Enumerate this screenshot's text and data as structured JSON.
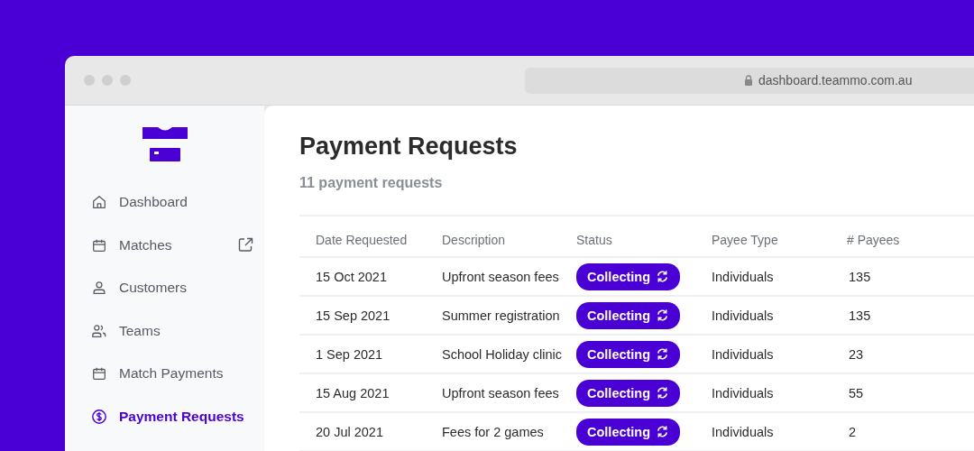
{
  "browser": {
    "url": "dashboard.teammo.com.au"
  },
  "sidebar": {
    "items": [
      {
        "label": "Dashboard",
        "selected": false,
        "external": false
      },
      {
        "label": "Matches",
        "selected": false,
        "external": true
      },
      {
        "label": "Customers",
        "selected": false,
        "external": false
      },
      {
        "label": "Teams",
        "selected": false,
        "external": false
      },
      {
        "label": "Match Payments",
        "selected": false,
        "external": false
      },
      {
        "label": "Payment Requests",
        "selected": true,
        "external": false
      }
    ]
  },
  "page": {
    "title": "Payment Requests",
    "subtitle": "11 payment requests"
  },
  "table": {
    "columns": [
      "Date Requested",
      "Description",
      "Status",
      "Payee Type",
      "# Payees"
    ],
    "rows": [
      {
        "date": "15 Oct 2021",
        "description": "Upfront season fees",
        "status": "Collecting",
        "payee_type": "Individuals",
        "payees": "135"
      },
      {
        "date": "15 Sep 2021",
        "description": "Summer registration",
        "status": "Collecting",
        "payee_type": "Individuals",
        "payees": "135"
      },
      {
        "date": "1 Sep 2021",
        "description": "School Holiday clinic",
        "status": "Collecting",
        "payee_type": "Individuals",
        "payees": "23"
      },
      {
        "date": "15 Aug 2021",
        "description": "Upfront season fees",
        "status": "Collecting",
        "payee_type": "Individuals",
        "payees": "55"
      },
      {
        "date": "20 Jul 2021",
        "description": "Fees for 2 games",
        "status": "Collecting",
        "payee_type": "Individuals",
        "payees": "2"
      }
    ]
  }
}
